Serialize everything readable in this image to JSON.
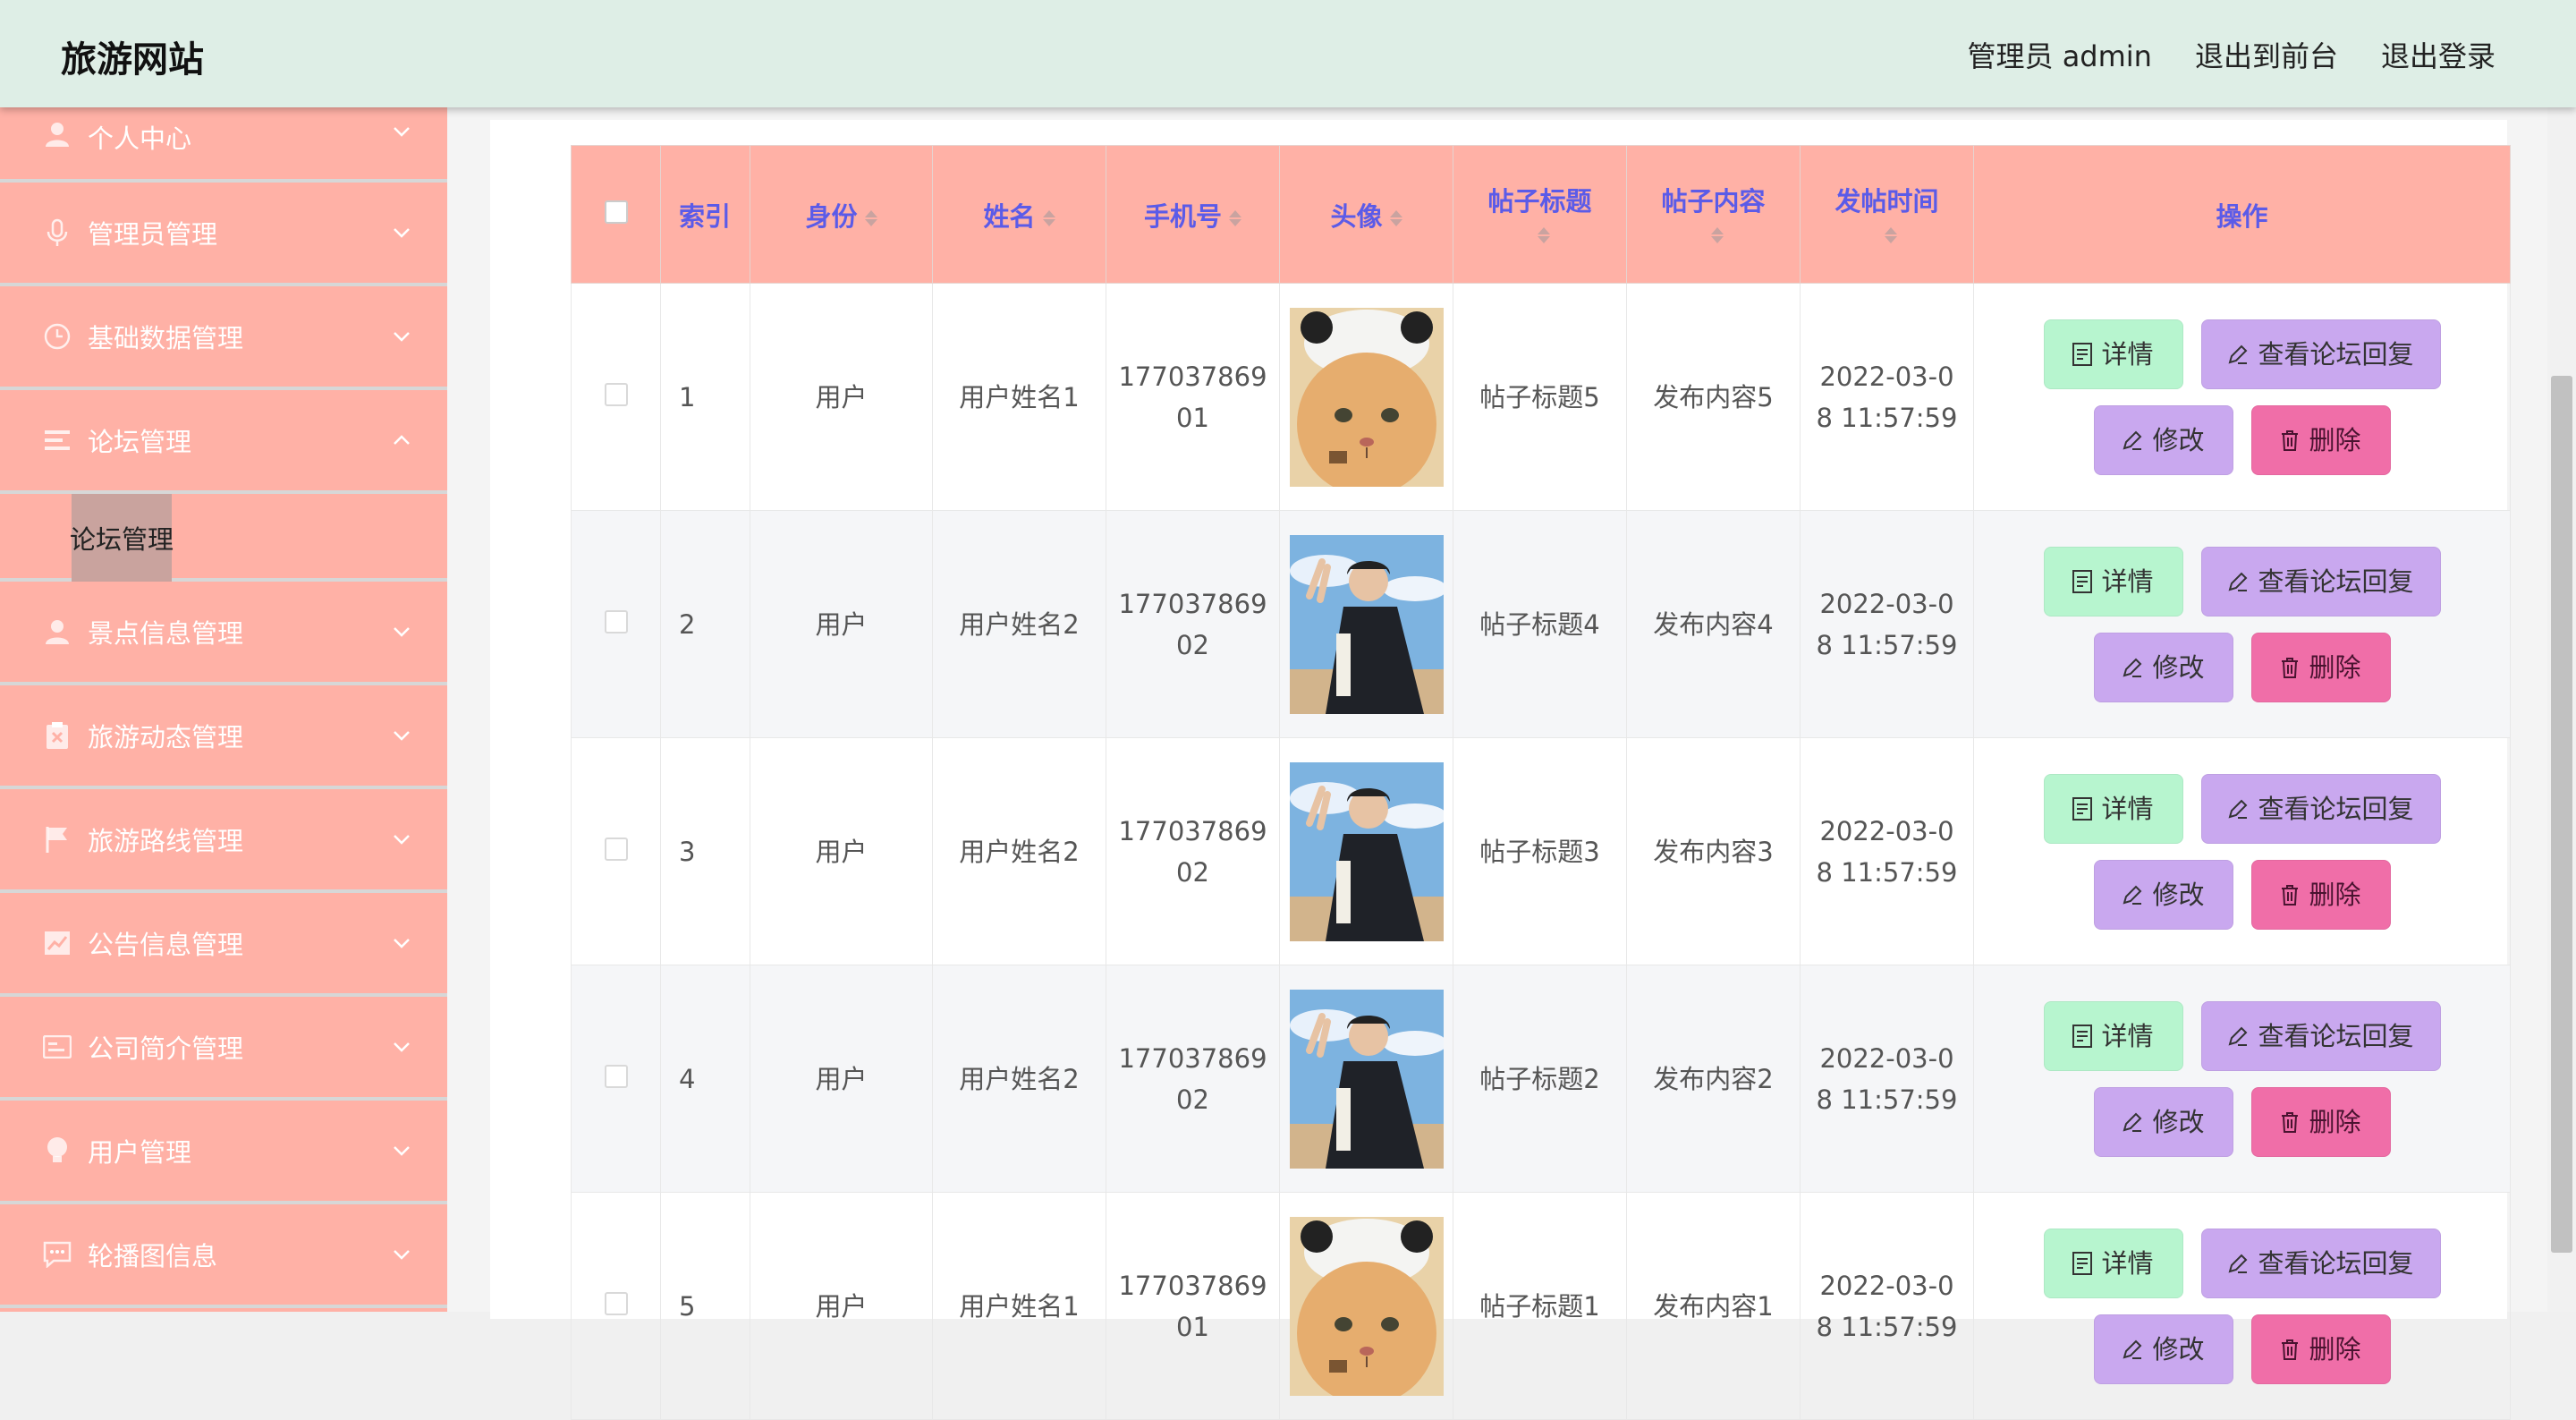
{
  "header": {
    "brand": "旅游网站",
    "links": [
      "管理员 admin",
      "退出到前台",
      "退出登录"
    ]
  },
  "sidebar": {
    "items": [
      {
        "label": "个人中心",
        "icon": "user-icon"
      },
      {
        "label": "管理员管理",
        "icon": "microphone-icon"
      },
      {
        "label": "基础数据管理",
        "icon": "clock-icon"
      },
      {
        "label": "论坛管理",
        "icon": "list-icon",
        "expanded": true,
        "sub": [
          "论坛管理"
        ]
      },
      {
        "label": "景点信息管理",
        "icon": "user-icon"
      },
      {
        "label": "旅游动态管理",
        "icon": "clipboard-icon"
      },
      {
        "label": "旅游路线管理",
        "icon": "flag-icon"
      },
      {
        "label": "公告信息管理",
        "icon": "chart-icon"
      },
      {
        "label": "公司简介管理",
        "icon": "card-icon"
      },
      {
        "label": "用户管理",
        "icon": "bulb-icon"
      },
      {
        "label": "轮播图信息",
        "icon": "message-icon"
      }
    ]
  },
  "table": {
    "headers": [
      "索引",
      "身份",
      "姓名",
      "手机号",
      "头像",
      "帖子标题",
      "帖子内容",
      "发帖时间",
      "操作"
    ],
    "rows": [
      {
        "index": "1",
        "role": "用户",
        "name": "用户姓名1",
        "phone": "17703786901",
        "avatar": "cat",
        "title": "帖子标题5",
        "content": "发布内容5",
        "time": "2022-03-08 11:57:59"
      },
      {
        "index": "2",
        "role": "用户",
        "name": "用户姓名2",
        "phone": "17703786902",
        "avatar": "boy",
        "title": "帖子标题4",
        "content": "发布内容4",
        "time": "2022-03-08 11:57:59"
      },
      {
        "index": "3",
        "role": "用户",
        "name": "用户姓名2",
        "phone": "17703786902",
        "avatar": "boy",
        "title": "帖子标题3",
        "content": "发布内容3",
        "time": "2022-03-08 11:57:59"
      },
      {
        "index": "4",
        "role": "用户",
        "name": "用户姓名2",
        "phone": "17703786902",
        "avatar": "boy",
        "title": "帖子标题2",
        "content": "发布内容2",
        "time": "2022-03-08 11:57:59"
      },
      {
        "index": "5",
        "role": "用户",
        "name": "用户姓名1",
        "phone": "17703786901",
        "avatar": "cat",
        "title": "帖子标题1",
        "content": "发布内容1",
        "time": "2022-03-08 11:57:59"
      }
    ],
    "actions": {
      "detail": "详情",
      "reply": "查看论坛回复",
      "edit": "修改",
      "delete": "删除"
    }
  },
  "colors": {
    "header_bg": "#deeee6",
    "sidebar_bg": "#ffb1a6",
    "header_text": "#5b5be8",
    "detail_btn": "#b7f5cf",
    "reply_btn": "#c9a8ef",
    "delete_btn": "#f06ea8"
  }
}
